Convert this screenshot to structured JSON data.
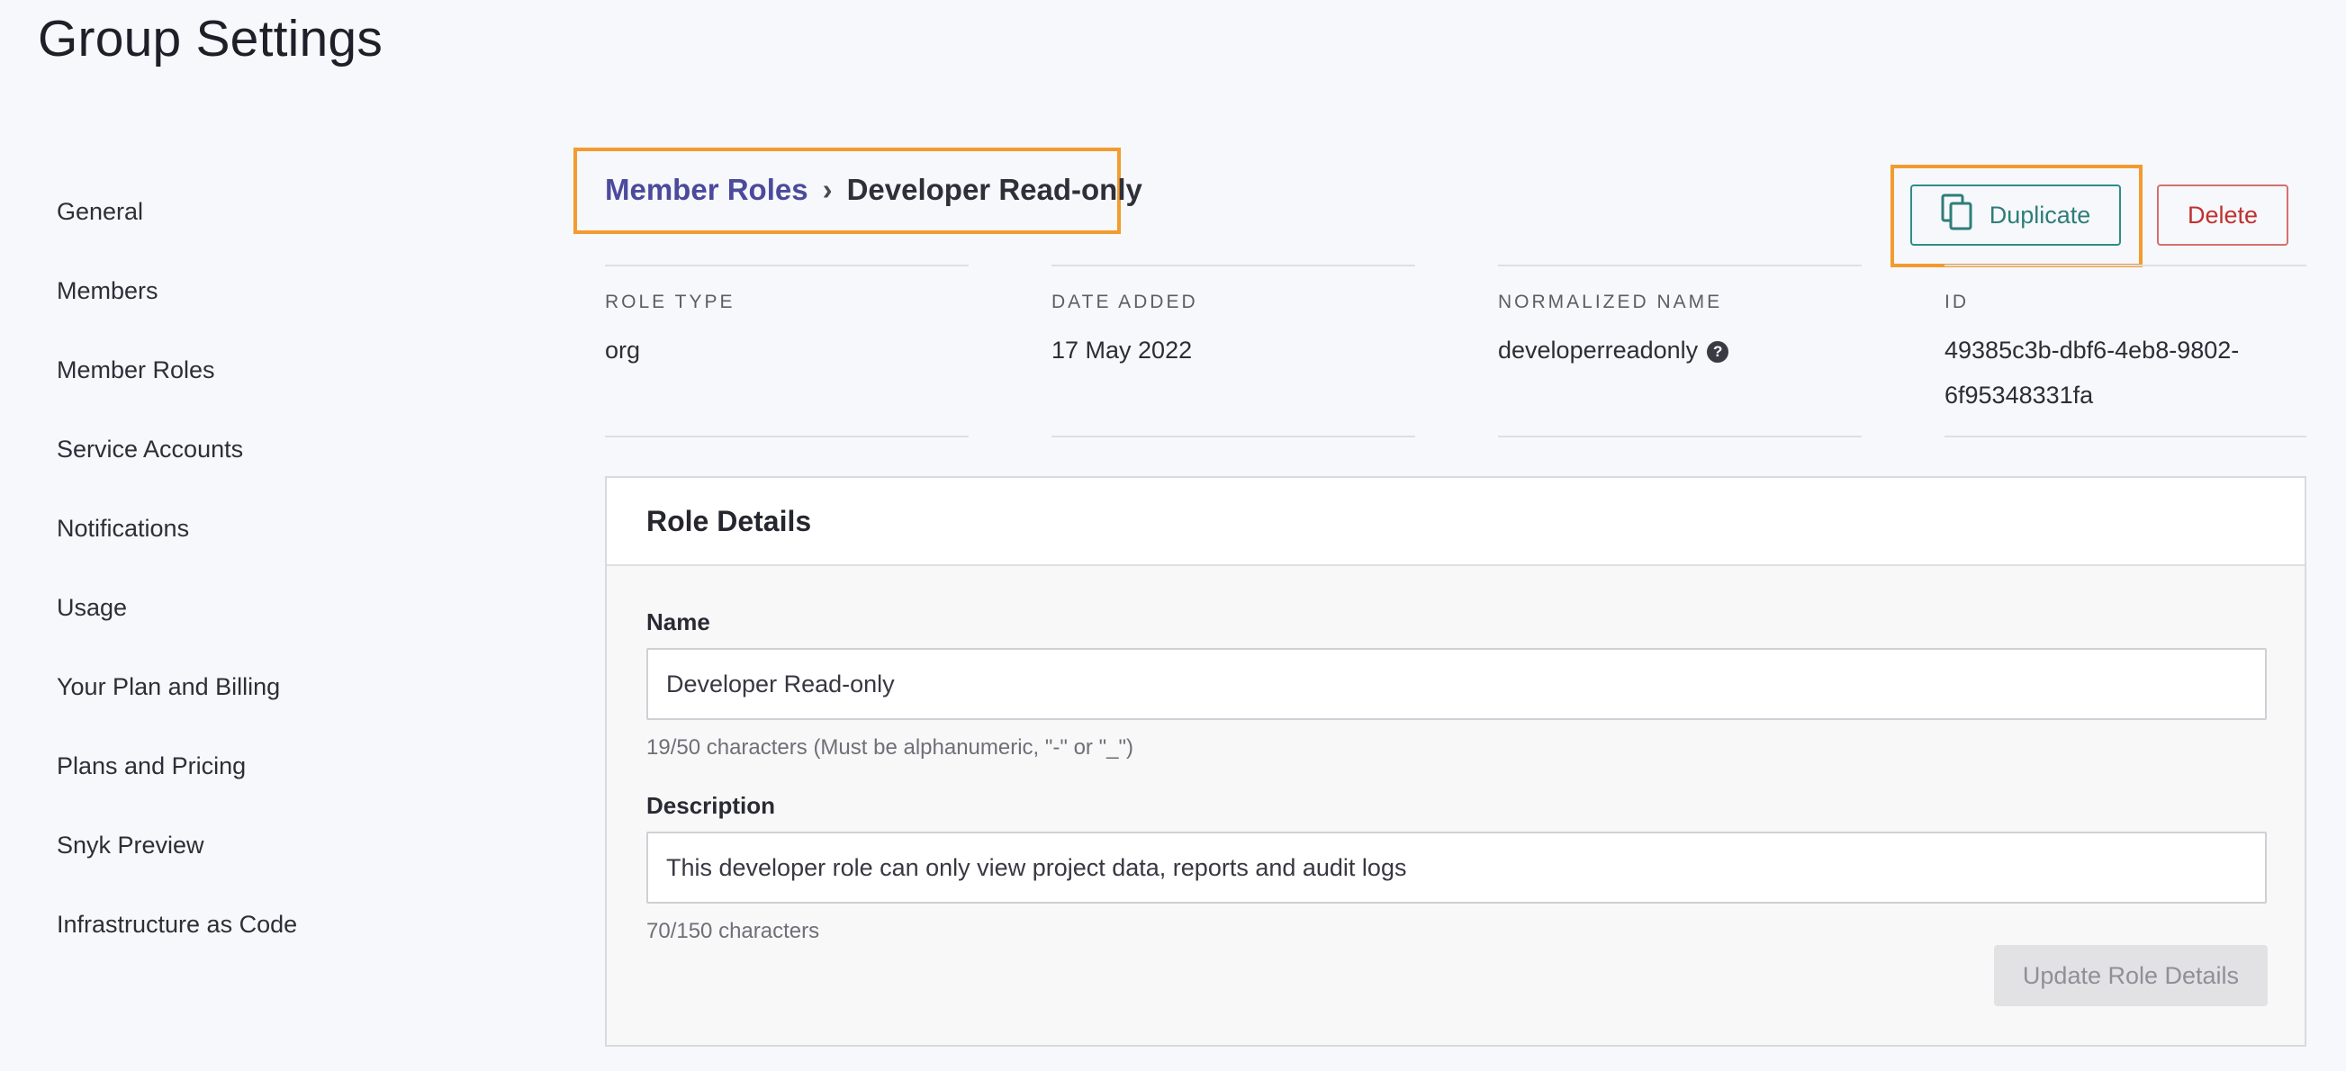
{
  "page_title": "Group Settings",
  "sidebar": {
    "items": [
      {
        "label": "General"
      },
      {
        "label": "Members"
      },
      {
        "label": "Member Roles"
      },
      {
        "label": "Service Accounts"
      },
      {
        "label": "Notifications"
      },
      {
        "label": "Usage"
      },
      {
        "label": "Your Plan and Billing"
      },
      {
        "label": "Plans and Pricing"
      },
      {
        "label": "Snyk Preview"
      },
      {
        "label": "Infrastructure as Code"
      }
    ]
  },
  "breadcrumb": {
    "parent": "Member Roles",
    "separator": "›",
    "current": "Developer Read-only"
  },
  "actions": {
    "duplicate_label": "Duplicate",
    "duplicate_icon": "copy-icon",
    "delete_label": "Delete"
  },
  "meta": {
    "role_type": {
      "label": "ROLE TYPE",
      "value": "org"
    },
    "date_added": {
      "label": "DATE ADDED",
      "value": "17 May 2022"
    },
    "normalized_name": {
      "label": "NORMALIZED NAME",
      "value": "developerreadonly",
      "help_icon": "question-circle-icon"
    },
    "id": {
      "label": "ID",
      "value_line1": "49385c3b-dbf6-4eb8-9802-",
      "value_line2": "6f95348331fa"
    }
  },
  "role_details": {
    "title": "Role Details",
    "name": {
      "label": "Name",
      "value": "Developer Read-only",
      "hint": "19/50 characters (Must be alphanumeric, \"-\" or \"_\")"
    },
    "description": {
      "label": "Description",
      "value": "This developer role can only view project data, reports and audit logs",
      "hint": "70/150 characters"
    },
    "update_label": "Update Role Details"
  },
  "colors": {
    "accent_link": "#4b4a9c",
    "highlight_outline": "#f39b2f",
    "duplicate_teal": "#2f7d7a",
    "delete_red": "#c0312f"
  }
}
